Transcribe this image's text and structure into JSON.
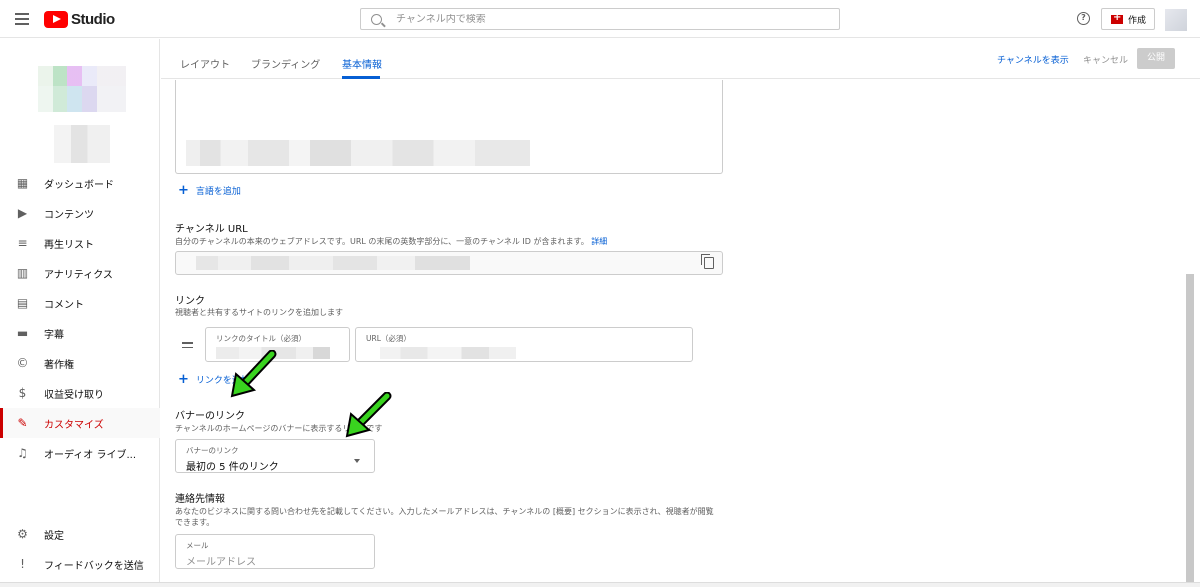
{
  "topbar": {
    "app_name": "Studio",
    "search_placeholder": "チャンネル内で検索",
    "help_glyph": "?",
    "create_label": "作成"
  },
  "sidebar": {
    "items": [
      {
        "label": "ダッシュボード",
        "icon": "dashboard-icon"
      },
      {
        "label": "コンテンツ",
        "icon": "content-icon"
      },
      {
        "label": "再生リスト",
        "icon": "playlist-icon"
      },
      {
        "label": "アナリティクス",
        "icon": "analytics-icon"
      },
      {
        "label": "コメント",
        "icon": "comment-icon"
      },
      {
        "label": "字幕",
        "icon": "subtitles-icon"
      },
      {
        "label": "著作権",
        "icon": "copyright-icon"
      },
      {
        "label": "収益受け取り",
        "icon": "dollar-icon"
      },
      {
        "label": "カスタマイズ",
        "icon": "magic-wand-icon",
        "active": true
      },
      {
        "label": "オーディオ ライブ...",
        "icon": "audio-library-icon"
      }
    ],
    "settings_label": "設定",
    "feedback_label": "フィードバックを送信"
  },
  "tabs": {
    "layout": "レイアウト",
    "branding": "ブランディング",
    "basic_info": "基本情報",
    "active": "basic_info"
  },
  "header_actions": {
    "view_channel": "チャンネルを表示",
    "cancel": "キャンセル",
    "publish": "公開"
  },
  "description": {
    "add_language": "言語を追加"
  },
  "channel_url": {
    "title": "チャンネル URL",
    "subtitle": "自分のチャンネルの本来のウェブアドレスです。URL の末尾の英数字部分に、一意のチャンネル ID が含まれます。",
    "details_link": "詳細"
  },
  "links": {
    "title": "リンク",
    "subtitle": "視聴者と共有するサイトのリンクを追加します",
    "link_title_label": "リンクのタイトル（必須）",
    "url_label": "URL（必須）",
    "add_link": "リンクを追加"
  },
  "banner_links": {
    "title": "バナーのリンク",
    "subtitle": "チャンネルのホームページのバナーに表示するリンクです",
    "select_label": "バナーのリンク",
    "select_value": "最初の 5 件のリンク"
  },
  "contact": {
    "title": "連絡先情報",
    "subtitle_line1": "あなたのビジネスに関する問い合わせ先を記載してください。入力したメールアドレスは、チャンネルの [概要] セクションに表示され、視聴者が閲覧",
    "subtitle_line2": "できます。",
    "email_label": "メール",
    "email_placeholder": "メールアドレス"
  },
  "colors": {
    "accent_blue": "#065fd4",
    "active_red": "#cc0000",
    "arrow_green": "#39d31f"
  }
}
